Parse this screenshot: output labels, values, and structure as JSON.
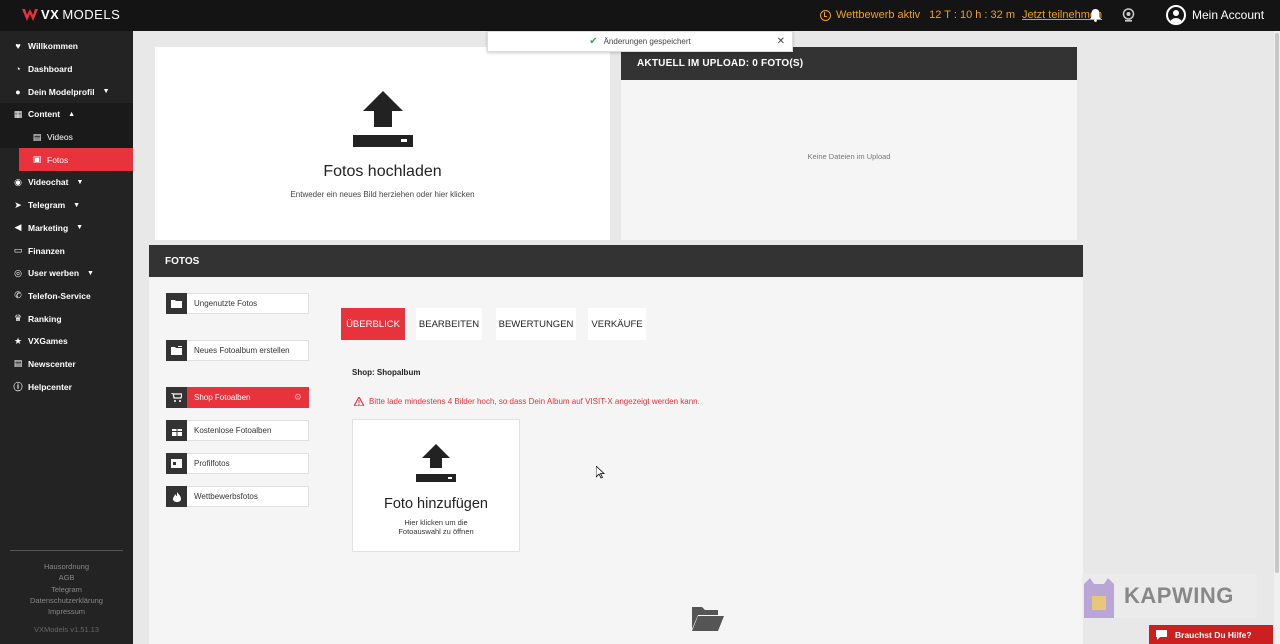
{
  "colors": {
    "accent": "#e8323c",
    "topbar": "#141414",
    "sidebar": "#232323",
    "contest": "#f0a020"
  },
  "topbar": {
    "logo_prefix": "VX",
    "logo_suffix": "MODELS",
    "contest_label": "Wettbewerb aktiv",
    "contest_timer": "12 T : 10 h : 32 m",
    "contest_link": "Jetzt teilnehmen",
    "bell_icon": "bell-icon",
    "webcam_icon": "webcam-icon",
    "account_label": "Mein Account"
  },
  "toast": {
    "message": "Änderungen gespeichert",
    "close_label": "✕"
  },
  "sidebar": {
    "items": [
      {
        "label": "Willkommen",
        "icon": "heart-icon"
      },
      {
        "label": "Dashboard",
        "icon": "dashboard-icon"
      },
      {
        "label": "Dein Modelprofil",
        "icon": "user-icon"
      },
      {
        "label": "Content",
        "icon": "film-icon"
      },
      {
        "label": "Videos",
        "icon": "video-icon"
      },
      {
        "label": "Fotos",
        "icon": "image-icon"
      },
      {
        "label": "Videochat",
        "icon": "webcam-icon"
      },
      {
        "label": "Telegram",
        "icon": "telegram-icon"
      },
      {
        "label": "Marketing",
        "icon": "megaphone-icon"
      },
      {
        "label": "Finanzen",
        "icon": "money-icon"
      },
      {
        "label": "User werben",
        "icon": "users-icon"
      },
      {
        "label": "Telefon-Service",
        "icon": "phone-icon"
      },
      {
        "label": "Ranking",
        "icon": "trophy-icon"
      },
      {
        "label": "VXGames",
        "icon": "star-icon"
      },
      {
        "label": "Newscenter",
        "icon": "news-icon"
      },
      {
        "label": "Helpcenter",
        "icon": "info-icon"
      }
    ],
    "footer_links": [
      "Hausordnung",
      "AGB",
      "Telegram",
      "Datenschutzerklärung",
      "Impressum"
    ],
    "version": "VXModels v1.51.13"
  },
  "upload": {
    "title": "Fotos hochladen",
    "subtitle": "Entweder ein neues Bild herziehen oder hier klicken",
    "queue_title": "AKTUELL IM UPLOAD: 0 FOTO(S)",
    "queue_empty": "Keine Dateien im Upload"
  },
  "fotos": {
    "header": "FOTOS",
    "albums": [
      {
        "label": "Ungenutzte Fotos",
        "icon": "folder-icon"
      },
      {
        "label": "Neues Fotoalbum erstellen",
        "icon": "folder-plus-icon"
      },
      {
        "label": "Shop Fotoalben",
        "icon": "cart-icon"
      },
      {
        "label": "Kostenlose Fotoalben",
        "icon": "gift-icon"
      },
      {
        "label": "Profilfotos",
        "icon": "id-card-icon"
      },
      {
        "label": "Wettbewerbsfotos",
        "icon": "fire-icon"
      }
    ],
    "tabs": [
      "ÜBERBLICK",
      "BEARBEITEN",
      "BEWERTUNGEN",
      "VERKÄUFE"
    ],
    "shop_title": "Shop: Shopalbum",
    "warning": "Bitte lade mindestens 4 Bilder hoch, so dass Dein Album auf VISIT-X angezeigt werden kann.",
    "add_title": "Foto hinzufügen",
    "add_sub_line1": "Hier klicken um die",
    "add_sub_line2": "Fotoauswahl zu öffnen"
  },
  "watermark": "KAPWING",
  "help_label": "Brauchst Du Hilfe?"
}
